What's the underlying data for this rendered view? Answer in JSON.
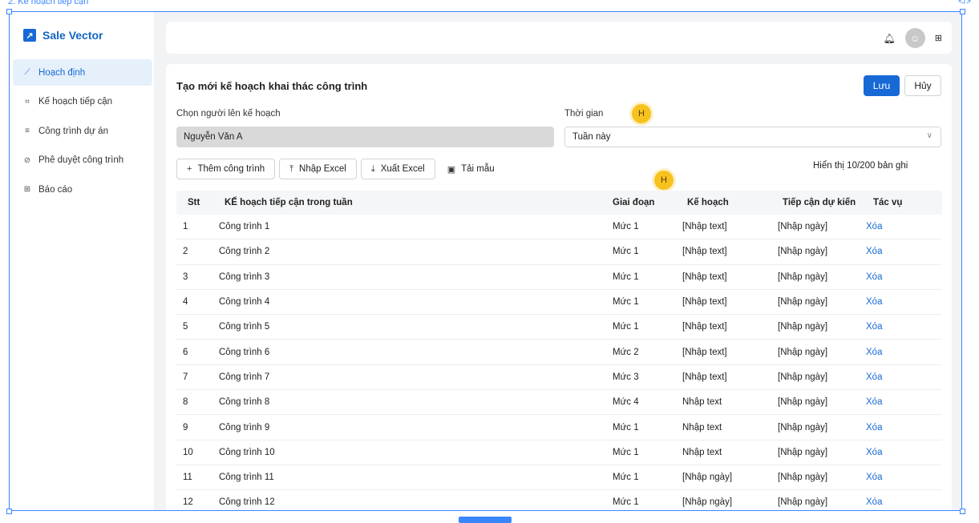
{
  "frame": {
    "label": "2. Kế hoạch tiếp cận",
    "code_icon": "code-icon"
  },
  "brand": {
    "name": "Sale Vector",
    "logo_icon": "arrow-up-right-icon"
  },
  "sidebar": {
    "items": [
      {
        "label": "Hoạch định",
        "icon": "chart-line-icon",
        "active": true
      },
      {
        "label": "Kế hoạch tiếp cận",
        "icon": "frame-icon",
        "active": false
      },
      {
        "label": "Công trình dự án",
        "icon": "list-icon",
        "active": false
      },
      {
        "label": "Phê duyệt công trình",
        "icon": "check-circle-icon",
        "active": false
      },
      {
        "label": "Báo cáo",
        "icon": "bar-chart-icon",
        "active": false
      }
    ]
  },
  "topbar": {
    "icons": [
      "bell-icon",
      "user-avatar-icon",
      "apps-grid-icon"
    ]
  },
  "form": {
    "title": "Tạo mới kế hoạch khai thác công trình",
    "save_label": "Lưu",
    "cancel_label": "Hủy",
    "person_label": "Chọn người lên kế hoạch",
    "person_value": "Nguyễn Văn A",
    "time_label": "Thời gian",
    "time_value": "Tuần này"
  },
  "markers": {
    "m1": "H",
    "m2": "H"
  },
  "toolbar": {
    "add_label": "Thêm công trình",
    "import_label": "Nhập Excel",
    "export_label": "Xuất Excel",
    "template_label": "Tải mẫu",
    "record_count": "Hiển thị 10/200 bản ghi"
  },
  "table": {
    "headers": [
      "Stt",
      "KẾ hoạch tiếp cận trong tuần",
      "Giai đoạn",
      "Kế hoạch",
      "Tiếp cận dự kiến",
      "Tác vụ"
    ],
    "rows": [
      [
        "1",
        "Công trình 1",
        "Mức 1",
        "[Nhập text]",
        "[Nhập ngày]",
        "Xóa"
      ],
      [
        "2",
        "Công trình 2",
        "Mức 1",
        "[Nhập text]",
        "[Nhập ngày]",
        "Xóa"
      ],
      [
        "3",
        "Công trình 3",
        "Mức 1",
        "[Nhập text]",
        "[Nhập ngày]",
        "Xóa"
      ],
      [
        "4",
        "Công trình 4",
        "Mức 1",
        "[Nhập text]",
        "[Nhập ngày]",
        "Xóa"
      ],
      [
        "5",
        "Công trình 5",
        "Mức 1",
        "[Nhập text]",
        "[Nhập ngày]",
        "Xóa"
      ],
      [
        "6",
        "Công trình 6",
        "Mức 2",
        "[Nhập text]",
        "[Nhập ngày]",
        "Xóa"
      ],
      [
        "7",
        "Công trình 7",
        "Mức 3",
        "[Nhập text]",
        "[Nhập ngày]",
        "Xóa"
      ],
      [
        "8",
        "Công trình 8",
        "Mức 4",
        "Nhập text",
        "[Nhập ngày]",
        "Xóa"
      ],
      [
        "9",
        "Công trình 9",
        "Mức 1",
        "Nhập text",
        "[Nhập ngày]",
        "Xóa"
      ],
      [
        "10",
        "Công trình 10",
        "Mức 1",
        "Nhập text",
        "[Nhập ngày]",
        "Xóa"
      ],
      [
        "11",
        "Công trình 11",
        "Mức 1",
        "[Nhập ngày]",
        "[Nhập ngày]",
        "Xóa"
      ],
      [
        "12",
        "Công trình 12",
        "Mức 1",
        "[Nhập ngày]",
        "[Nhập ngày]",
        "Xóa"
      ]
    ]
  },
  "colors": {
    "accent": "#1769d6",
    "marker": "#f7c21e",
    "selection": "#3a86ff"
  }
}
